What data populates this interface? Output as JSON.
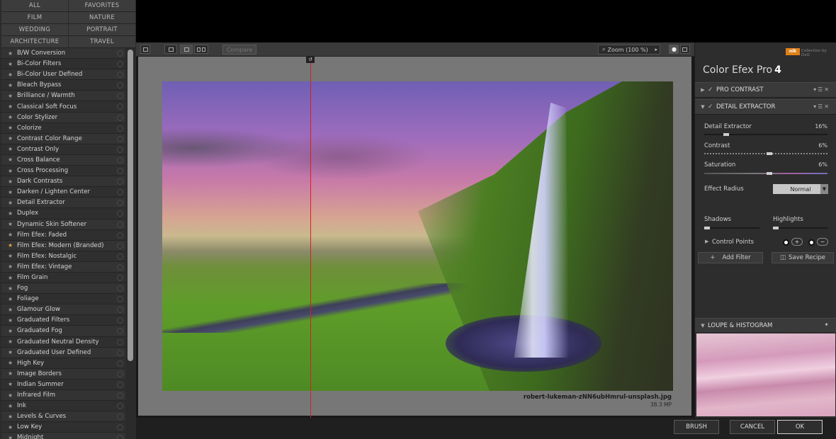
{
  "categories": [
    "ALL",
    "FAVORITES",
    "FILM",
    "NATURE",
    "WEDDING",
    "PORTRAIT",
    "ARCHITECTURE",
    "TRAVEL"
  ],
  "filters": [
    "B/W Conversion",
    "Bi-Color Filters",
    "Bi-Color User Defined",
    "Bleach Bypass",
    "Brilliance / Warmth",
    "Classical Soft Focus",
    "Color Stylizer",
    "Colorize",
    "Contrast Color Range",
    "Contrast Only",
    "Cross Balance",
    "Cross Processing",
    "Dark Contrasts",
    "Darken / Lighten Center",
    "Detail Extractor",
    "Duplex",
    "Dynamic Skin Softener",
    "Film Efex: Faded",
    "Film Efex: Modern (Branded)",
    "Film Efex: Nostalgic",
    "Film Efex: Vintage",
    "Film Grain",
    "Fog",
    "Foliage",
    "Glamour Glow",
    "Graduated Filters",
    "Graduated Fog",
    "Graduated Neutral Density",
    "Graduated User Defined",
    "High Key",
    "Image Borders",
    "Indian Summer",
    "Infrared Film",
    "Ink",
    "Levels & Curves",
    "Low Key",
    "Midnight"
  ],
  "favorite_filter": "Film Efex: Modern (Branded)",
  "toolbar": {
    "compare_label": "Compare",
    "zoom_label": "Zoom (100 %)"
  },
  "canvas": {
    "file_name": "robert-lukeman-zNN6ubHmrul-unsplash.jpg",
    "megapixels": "38.3 MP"
  },
  "bottom": {
    "brush": "BRUSH",
    "cancel": "CANCEL",
    "ok": "OK"
  },
  "panel": {
    "brand_logo": "nik",
    "brand_by": "Collection by DxO",
    "app_name": "Color Efex Pro",
    "app_version": "4",
    "filter1": "PRO CONTRAST",
    "filter2": "DETAIL EXTRACTOR",
    "sliders": {
      "detail_extractor": {
        "label": "Detail Extractor",
        "value": "16%",
        "level": 0.16
      },
      "contrast": {
        "label": "Contrast",
        "value": "6%",
        "level": 0.53
      },
      "saturation": {
        "label": "Saturation",
        "value": "6%",
        "level": 0.53
      }
    },
    "effect_radius_label": "Effect Radius",
    "effect_radius_value": "Normal",
    "shadows_label": "Shadows",
    "highlights_label": "Highlights",
    "control_points_label": "Control Points",
    "add_filter": "Add Filter",
    "save_recipe": "Save Recipe",
    "loupe_label": "LOUPE & HISTOGRAM"
  },
  "colors": {
    "split_line": "#d42020",
    "brand": "#e0801a",
    "panel_bg": "#2d2d2d"
  }
}
